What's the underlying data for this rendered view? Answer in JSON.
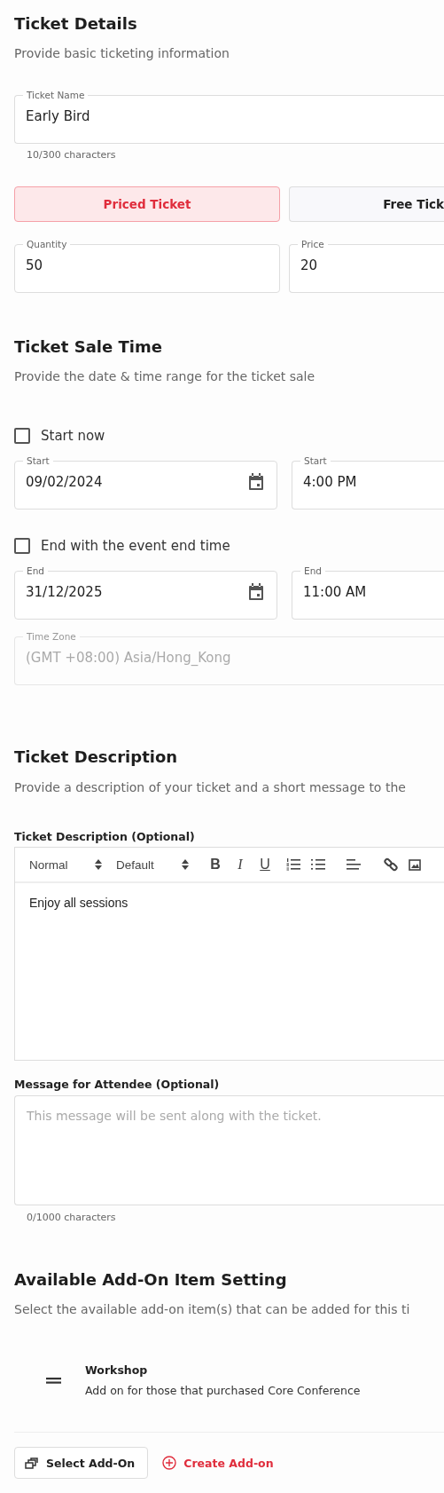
{
  "ticket_details": {
    "title": "Ticket Details",
    "subtitle": "Provide basic ticketing information",
    "ticket_name": {
      "label": "Ticket Name",
      "value": "Early Bird",
      "counter": "10/300 characters"
    },
    "ticket_types": [
      {
        "label": "Priced Ticket",
        "selected": true
      },
      {
        "label": "Free Tick",
        "selected": false
      }
    ],
    "quantity": {
      "label": "Quantity",
      "value": "50"
    },
    "price": {
      "label": "Price",
      "value": "20"
    }
  },
  "sale_time": {
    "title": "Ticket Sale Time",
    "subtitle": "Provide the date & time range for the ticket sale",
    "start_now": {
      "label": "Start now",
      "checked": false
    },
    "start_date": {
      "label": "Start",
      "value": "09/02/2024"
    },
    "start_time": {
      "label": "Start",
      "value": "4:00 PM"
    },
    "end_with_event": {
      "label": "End with the event end time",
      "checked": false
    },
    "end_date": {
      "label": "End",
      "value": "31/12/2025"
    },
    "end_time": {
      "label": "End",
      "value": "11:00 AM"
    },
    "time_zone": {
      "label": "Time Zone",
      "value": "(GMT +08:00) Asia/Hong_Kong",
      "disabled": true
    }
  },
  "description": {
    "title": "Ticket Description",
    "subtitle": "Provide a description of your ticket and a short message to the",
    "editor": {
      "label": "Ticket Description (Optional)",
      "format": "Normal",
      "font": "Default",
      "style_buttons": [
        "B",
        "I",
        "U"
      ],
      "content": "Enjoy all sessions"
    },
    "message": {
      "label": "Message for Attendee (Optional)",
      "placeholder": "This message will be sent along with the ticket.",
      "counter": "0/1000 characters"
    }
  },
  "addons": {
    "title": "Available Add-On Item Setting",
    "subtitle": "Select the available add-on item(s) that can be added for this ti",
    "items": [
      {
        "name": "Workshop",
        "description": "Add on for those that purchased Core Conference"
      }
    ],
    "select_button": "Select Add-On",
    "create_button": "Create Add-on"
  }
}
